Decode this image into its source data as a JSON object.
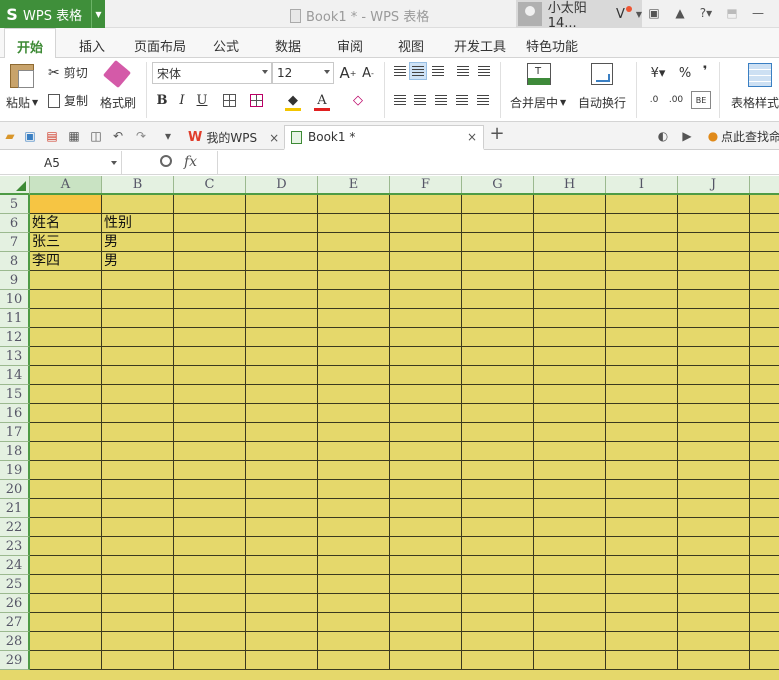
{
  "titlebar": {
    "app_name": "WPS 表格",
    "app_logo": "S",
    "doc_title": "Book1 * - WPS 表格",
    "user_name": "小太阳14...",
    "vip_mark": "V"
  },
  "menu": {
    "tabs": [
      "开始",
      "插入",
      "页面布局",
      "公式",
      "数据",
      "审阅",
      "视图",
      "开发工具",
      "特色功能"
    ]
  },
  "ribbon": {
    "paste": "粘贴",
    "cut": "剪切",
    "copy": "复制",
    "format_painter": "格式刷",
    "font_name": "宋体",
    "font_size": "12",
    "bold": "B",
    "italic": "I",
    "underline": "U",
    "merge_center": "合并居中",
    "wrap_text": "自动换行",
    "percent": "%",
    "comma": "❜",
    "table_style": "表格样式"
  },
  "quickbar": {
    "tabs": [
      {
        "label": "我的WPS",
        "close": "×"
      },
      {
        "label": "Book1 *",
        "close": "×"
      }
    ],
    "new_tab": "+",
    "search_hint": "点此查找命"
  },
  "formula_bar": {
    "name_box": "A5",
    "fx_label": "fx",
    "formula": ""
  },
  "sheet": {
    "columns": [
      "A",
      "B",
      "C",
      "D",
      "E",
      "F",
      "G",
      "H",
      "I",
      "J",
      ""
    ],
    "rows": [
      {
        "num": "5",
        "cells": [
          "",
          ""
        ]
      },
      {
        "num": "6",
        "cells": [
          "姓名",
          "性别"
        ]
      },
      {
        "num": "7",
        "cells": [
          "张三",
          "男"
        ]
      },
      {
        "num": "8",
        "cells": [
          "李四",
          "男"
        ]
      },
      {
        "num": "9",
        "cells": [
          "",
          ""
        ]
      },
      {
        "num": "10",
        "cells": [
          "",
          ""
        ]
      },
      {
        "num": "11",
        "cells": [
          "",
          ""
        ]
      },
      {
        "num": "12",
        "cells": [
          "",
          ""
        ]
      },
      {
        "num": "13",
        "cells": [
          "",
          ""
        ]
      },
      {
        "num": "14",
        "cells": [
          "",
          ""
        ]
      },
      {
        "num": "15",
        "cells": [
          "",
          ""
        ]
      },
      {
        "num": "16",
        "cells": [
          "",
          ""
        ]
      },
      {
        "num": "17",
        "cells": [
          "",
          ""
        ]
      },
      {
        "num": "18",
        "cells": [
          "",
          ""
        ]
      },
      {
        "num": "19",
        "cells": [
          "",
          ""
        ]
      },
      {
        "num": "20",
        "cells": [
          "",
          ""
        ]
      },
      {
        "num": "21",
        "cells": [
          "",
          ""
        ]
      },
      {
        "num": "22",
        "cells": [
          "",
          ""
        ]
      },
      {
        "num": "23",
        "cells": [
          "",
          ""
        ]
      },
      {
        "num": "24",
        "cells": [
          "",
          ""
        ]
      },
      {
        "num": "25",
        "cells": [
          "",
          ""
        ]
      },
      {
        "num": "26",
        "cells": [
          "",
          ""
        ]
      },
      {
        "num": "27",
        "cells": [
          "",
          ""
        ]
      },
      {
        "num": "28",
        "cells": [
          "",
          ""
        ]
      },
      {
        "num": "29",
        "cells": [
          "",
          ""
        ]
      }
    ],
    "active_cell": "A5",
    "cell_fill_color": "#e5d86b",
    "active_fill_color": "#f6c543",
    "accent_color": "#3d8a35"
  }
}
